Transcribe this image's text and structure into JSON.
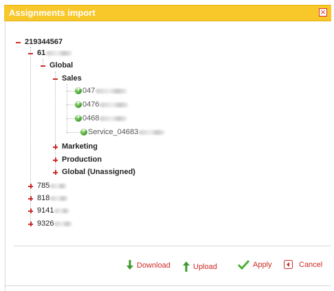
{
  "dialog": {
    "title": "Assignments import",
    "close_icon": "close-icon"
  },
  "tree": {
    "nodes": [
      {
        "label": "219344567",
        "expanded": true,
        "bold": true
      },
      {
        "label": "61",
        "expanded": true,
        "bold": true
      },
      {
        "label": "Global",
        "expanded": true,
        "bold": true
      },
      {
        "label": "Sales",
        "expanded": true,
        "bold": true
      },
      {
        "label": "047",
        "leaf": true
      },
      {
        "label": "0476",
        "leaf": true
      },
      {
        "label": "0468",
        "leaf": true
      },
      {
        "label": "Service_04683",
        "leaf": true
      },
      {
        "label": "Marketing",
        "expanded": false,
        "bold": true
      },
      {
        "label": "Production",
        "expanded": false,
        "bold": true
      },
      {
        "label": "Global (Unassigned)",
        "expanded": false,
        "bold": true
      },
      {
        "label": "785",
        "expanded": false
      },
      {
        "label": "818",
        "expanded": false
      },
      {
        "label": "9141",
        "expanded": false
      },
      {
        "label": "9326",
        "expanded": false
      }
    ]
  },
  "actions": {
    "download": "Download",
    "upload": "Upload",
    "apply": "Apply",
    "cancel": "Cancel"
  },
  "colors": {
    "titlebar": "#f8c72a",
    "accent": "#cc2a26",
    "leaf_icon": "#3e9b2e"
  }
}
